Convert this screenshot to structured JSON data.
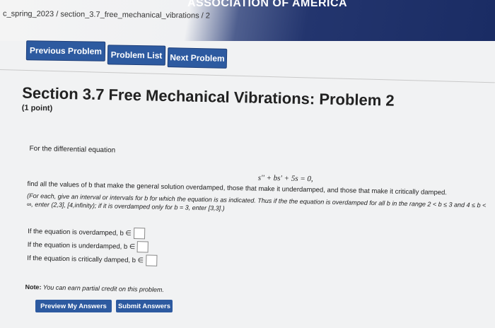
{
  "banner": {
    "title": "ASSOCIATION OF AMERICA"
  },
  "breadcrumb": {
    "course": "c_spring_2023",
    "sep1": " / ",
    "set": "section_3.7_free_mechanical_vibrations",
    "sep2": " / ",
    "problem": "2"
  },
  "nav": {
    "previous_label": "Previous Problem",
    "list_label": "Problem List",
    "next_label": "Next Problem"
  },
  "problem": {
    "title": "Section 3.7 Free Mechanical Vibrations: Problem 2",
    "points": "(1 point)",
    "prompt": "For the differential equation",
    "equation": "s'' + bs' + 5s = 0,",
    "instruction": "find all the values of b that make the general solution overdamped, those that make it underdamped, and those that make it critically damped.",
    "hint": "(For each, give an interval or intervals for b for which the equation is as indicated. Thus if the the equation is overdamped for all b in the range 2 < b ≤ 3 and 4 ≤ b < ∞, enter (2,3], [4,infinity); if it is overdamped only for b = 3, enter [3,3].)",
    "answers": {
      "overdamped_label": "If the equation is overdamped, b ∈",
      "underdamped_label": "If the equation is underdamped, b ∈",
      "critical_label": "If the equation is critically damped, b ∈"
    },
    "note_label": "Note:",
    "note_text": " You can earn partial credit on this problem."
  },
  "actions": {
    "preview_label": "Preview My Answers",
    "submit_label": "Submit Answers"
  },
  "colors": {
    "button_blue": "#2d5aa0",
    "banner_navy": "#1a2c64",
    "page_bg": "#f1f2f3"
  }
}
